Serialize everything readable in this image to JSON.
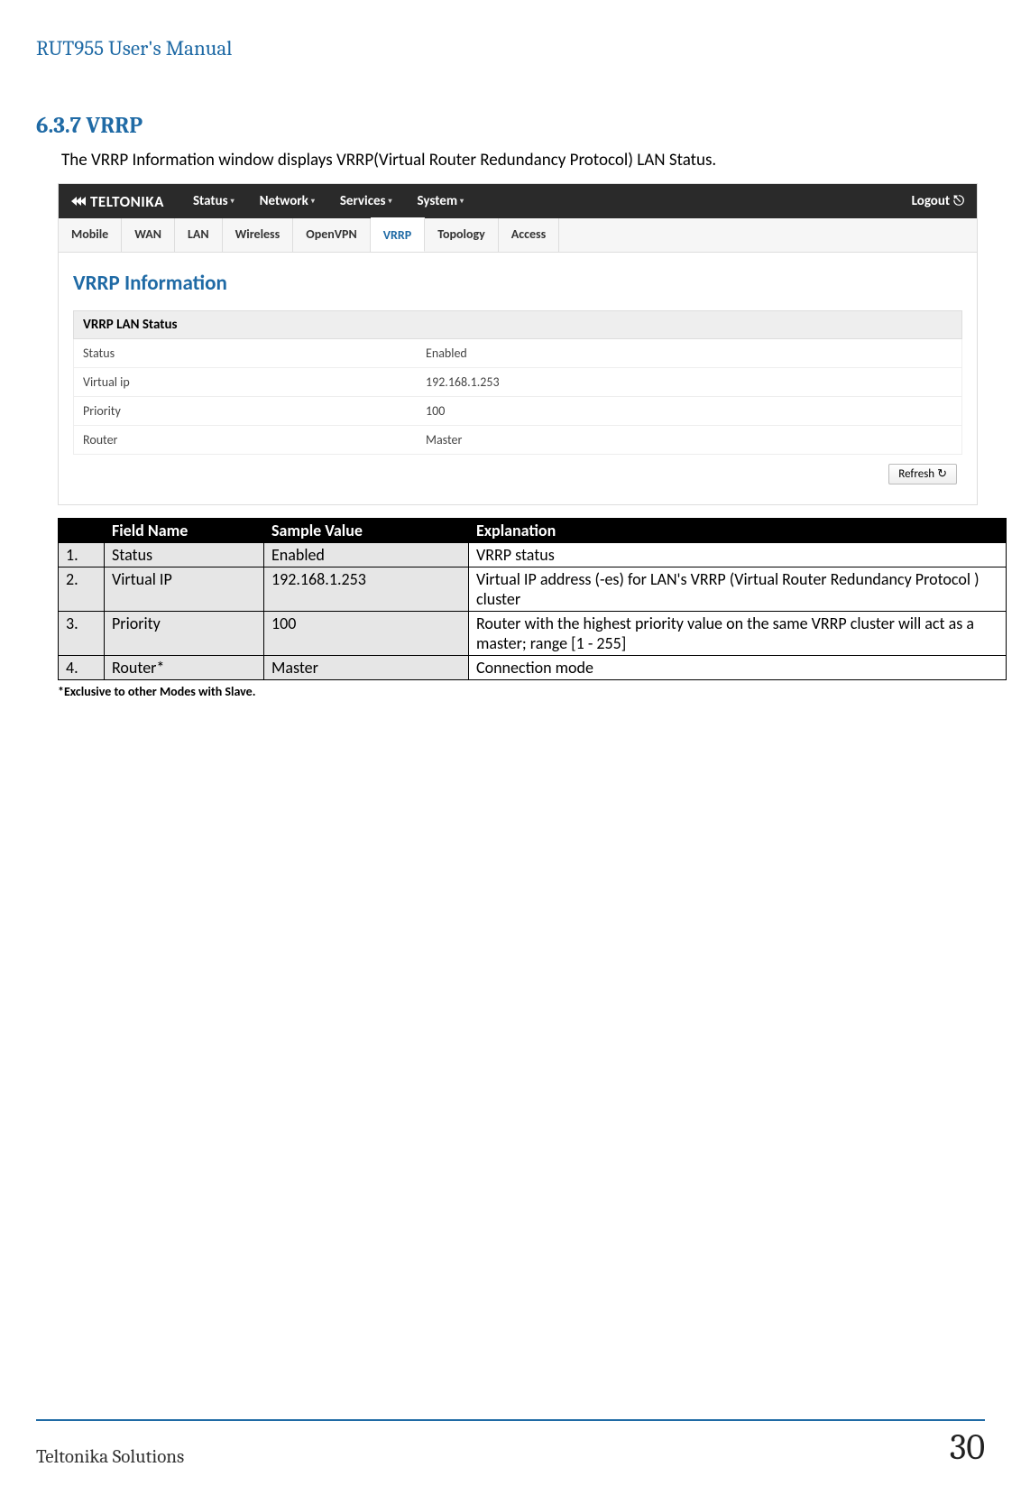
{
  "doc": {
    "header": "RUT955 User's Manual",
    "section_number_title": "6.3.7 VRRP",
    "intro": "The VRRP Information window displays VRRP(Virtual Router Redundancy Protocol) LAN Status.",
    "footnote": "*Exclusive to other Modes with Slave.",
    "footer_left": "Teltonika Solutions",
    "footer_right": "30"
  },
  "ui": {
    "brand": "TELTONIKA",
    "nav": {
      "status": "Status",
      "network": "Network",
      "services": "Services",
      "system": "System"
    },
    "logout": "Logout",
    "subtabs": {
      "mobile": "Mobile",
      "wan": "WAN",
      "lan": "LAN",
      "wireless": "Wireless",
      "openvpn": "OpenVPN",
      "vrrp": "VRRP",
      "topology": "Topology",
      "access": "Access"
    },
    "panel_title": "VRRP Information",
    "section_header": "VRRP LAN Status",
    "rows": {
      "status": {
        "label": "Status",
        "value": "Enabled"
      },
      "vip": {
        "label": "Virtual ip",
        "value": "192.168.1.253"
      },
      "prio": {
        "label": "Priority",
        "value": "100"
      },
      "router": {
        "label": "Router",
        "value": "Master"
      }
    },
    "refresh": "Refresh"
  },
  "table": {
    "headers": {
      "num": "",
      "field": "Field Name",
      "sample": "Sample Value",
      "explain": "Explanation"
    },
    "r1": {
      "n": "1.",
      "f": "Status",
      "s": "Enabled",
      "e": "VRRP status"
    },
    "r2": {
      "n": "2.",
      "f": "Virtual IP",
      "s": "192.168.1.253",
      "e": "Virtual IP address (-es) for LAN's VRRP (Virtual Router Redundancy Protocol ) cluster"
    },
    "r3": {
      "n": "3.",
      "f": "Priority",
      "s": "100",
      "e": "Router with the highest priority value on the same VRRP cluster will act as a master; range [1 - 255]"
    },
    "r4": {
      "n": "4.",
      "f": "Router*",
      "s": "Master",
      "e": "Connection mode"
    }
  }
}
